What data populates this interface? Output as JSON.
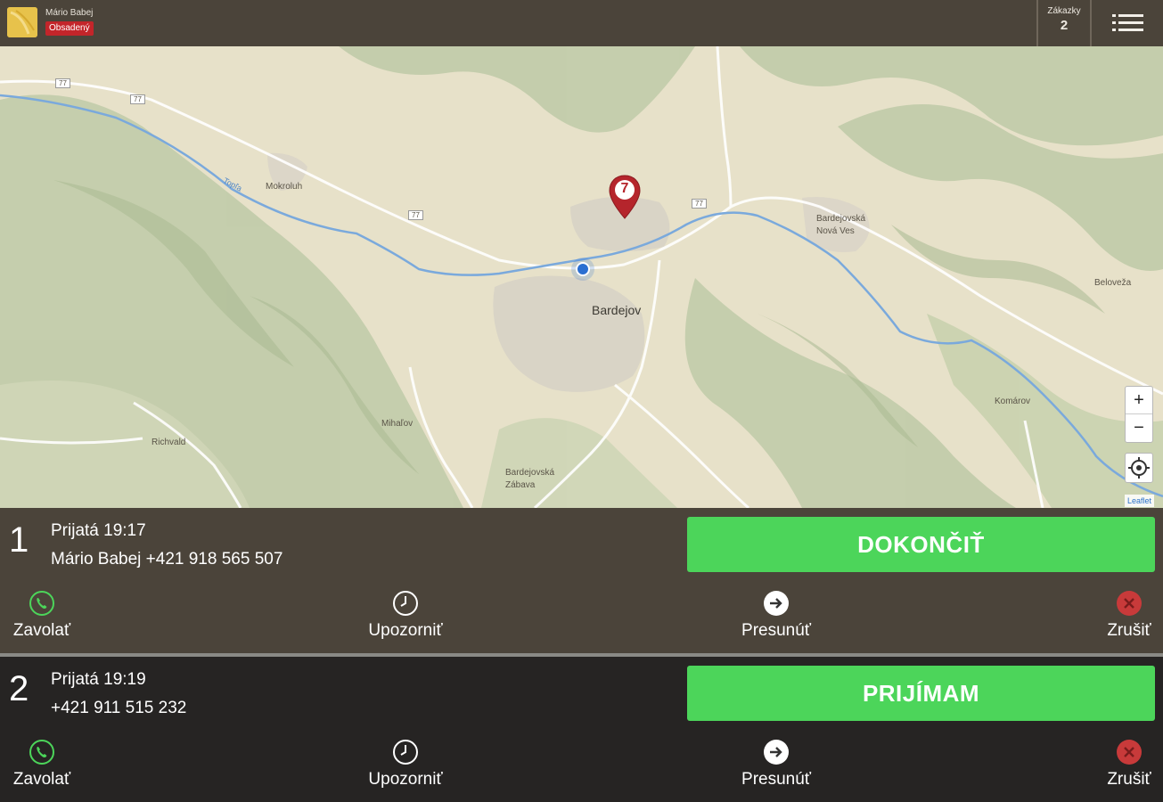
{
  "header": {
    "driver_name": "Mário Babej",
    "status": "Obsadený",
    "orders_label": "Zákazky",
    "orders_count": "2"
  },
  "map": {
    "places": {
      "mokroluh": "Mokroluh",
      "bardejov": "Bardejov",
      "nova_ves": "Bardejovská Nová Ves",
      "beloveza": "Beloveža",
      "komarov": "Komárov",
      "richvald": "Richvald",
      "mihalov": "Mihaľov",
      "zabava": "Bardejovská Zábava"
    },
    "road_numbers": [
      "77",
      "77",
      "77",
      "77"
    ],
    "river": "Topľa",
    "marker_number": "7",
    "zoom_in": "+",
    "zoom_out": "−",
    "attribution": "Leaflet"
  },
  "orders": [
    {
      "number": "1",
      "received": "Prijatá 19:17",
      "contact": "Mário Babej +421 918 565 507",
      "primary_action": "DOKONČIŤ",
      "actions": {
        "call": "Zavolať",
        "notify": "Upozorniť",
        "move": "Presunúť",
        "cancel": "Zrušiť"
      }
    },
    {
      "number": "2",
      "received": "Prijatá 19:19",
      "contact": "+421 911 515 232",
      "primary_action": "PRIJÍMAM",
      "actions": {
        "call": "Zavolať",
        "notify": "Upozorniť",
        "move": "Presunúť",
        "cancel": "Zrušiť"
      }
    }
  ],
  "colors": {
    "topbar": "#4b443a",
    "order_active_bg": "#4b443a",
    "order_pending_bg": "#262423",
    "primary_green": "#4cd55a",
    "status_red": "#c3252a",
    "cancel_red": "#c83a3a",
    "marker_red": "#b5252c",
    "gps_blue": "#2b6fd1"
  }
}
